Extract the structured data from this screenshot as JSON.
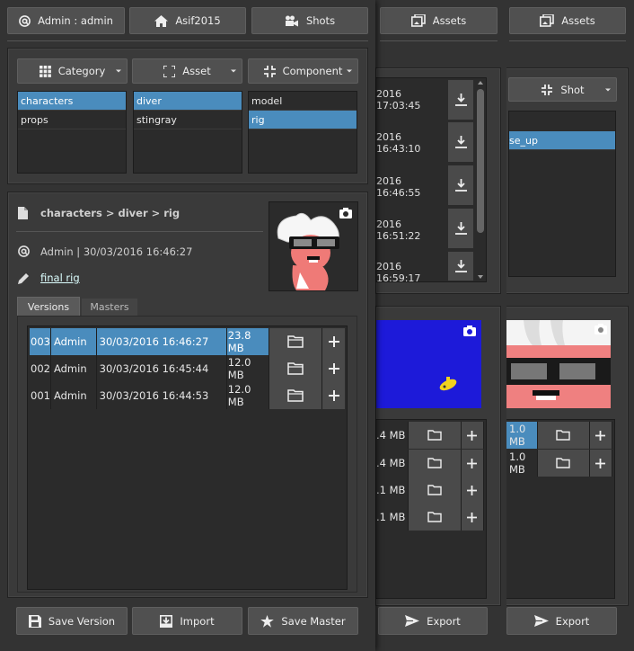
{
  "nav": {
    "user_label": "Admin : admin",
    "project_label": "Asif2015",
    "shots_label": "Shots",
    "assets_label_1": "Assets",
    "assets_label_2": "Assets"
  },
  "filters": {
    "category_label": "Category",
    "asset_label": "Asset",
    "component_label": "Component",
    "shot_label": "Shot",
    "categories": [
      {
        "label": "characters",
        "selected": true
      },
      {
        "label": "props",
        "selected": false
      }
    ],
    "assets": [
      {
        "label": "diver",
        "selected": true
      },
      {
        "label": "stingray",
        "selected": false
      }
    ],
    "components": [
      {
        "label": "model",
        "selected": false
      },
      {
        "label": "rig",
        "selected": true
      }
    ],
    "shots_partial": [
      {
        "label": "se_up",
        "selected": true
      }
    ]
  },
  "details": {
    "path": "characters > diver > rig",
    "author_line": "Admin | 30/03/2016 16:46:27",
    "comment": "final rig"
  },
  "tabs": {
    "versions": "Versions",
    "masters": "Masters"
  },
  "versions": [
    {
      "id": "003",
      "user": "Admin",
      "date": "30/03/2016 16:46:27",
      "size": "23.8 MB",
      "selected": true
    },
    {
      "id": "002",
      "user": "Admin",
      "date": "30/03/2016 16:45:44",
      "size": "12.0 MB",
      "selected": false
    },
    {
      "id": "001",
      "user": "Admin",
      "date": "30/03/2016 16:44:53",
      "size": "12.0 MB",
      "selected": false
    }
  ],
  "actions": {
    "save_version": "Save Version",
    "import": "Import",
    "save_master": "Save Master",
    "export_1": "Export",
    "export_2": "Export"
  },
  "bg_times": [
    "2016 17:03:45",
    "2016 16:43:10",
    "2016 16:46:55",
    "2016 16:51:22",
    "2016 16:59:17"
  ],
  "bg_sizes_1": [
    ".4 MB",
    ".4 MB",
    ".1 MB",
    ".1 MB"
  ],
  "bg_sizes_2": [
    "1.0 MB",
    "1.0 MB"
  ],
  "colors": {
    "selection": "#4a8cbd",
    "panel": "#3a3a3a",
    "list_bg": "#2b2b2b",
    "button": "#505050"
  }
}
